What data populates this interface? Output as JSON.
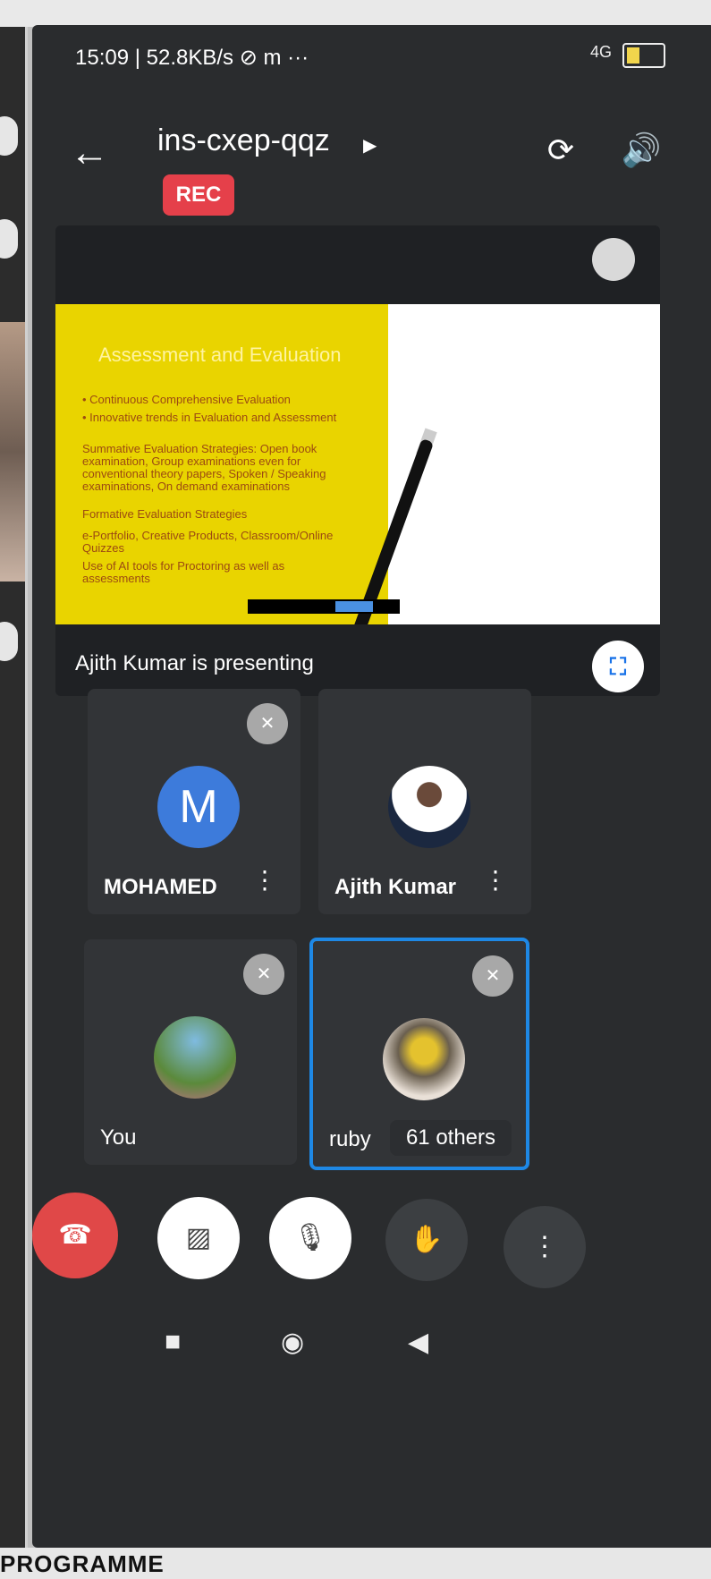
{
  "status_bar": {
    "time_speed": "15:09 | 52.8KB/s ⊘ m ···",
    "network": "4G",
    "battery_level": "16"
  },
  "header": {
    "meeting_code": "ins-cxep-qqz",
    "rec_label": "REC"
  },
  "presentation": {
    "slide_title": "Assessment and Evaluation",
    "bullets": [
      "• Continuous Comprehensive Evaluation",
      "• Innovative trends in Evaluation and Assessment",
      "Summative Evaluation Strategies: Open book examination, Group examinations even for conventional theory papers, Spoken / Speaking examinations, On demand examinations",
      "Formative Evaluation Strategies",
      "e-Portfolio, Creative Products, Classroom/Online Quizzes",
      "Use of AI tools for Proctoring as well as assessments"
    ],
    "caption": "Ajith Kumar is presenting"
  },
  "participants": [
    {
      "name": "MOHAMED",
      "initial": "M"
    },
    {
      "name": "Ajith Kumar"
    },
    {
      "name": "You"
    },
    {
      "name": "ruby",
      "others": "61 others"
    }
  ],
  "colors": {
    "end_call": "#e04848",
    "rec": "#e5404a",
    "active_border": "#1e88e5",
    "avatar_letter_bg": "#3d7bdb"
  },
  "icons": [
    "back-arrow-icon",
    "switch-camera-icon",
    "speaker-icon",
    "mic-off-icon",
    "hangup-icon",
    "camera-off-icon",
    "raise-hand-icon",
    "more-vert-icon",
    "fullscreen-icon"
  ],
  "page_footer": {
    "text": "PROGRAMME"
  }
}
